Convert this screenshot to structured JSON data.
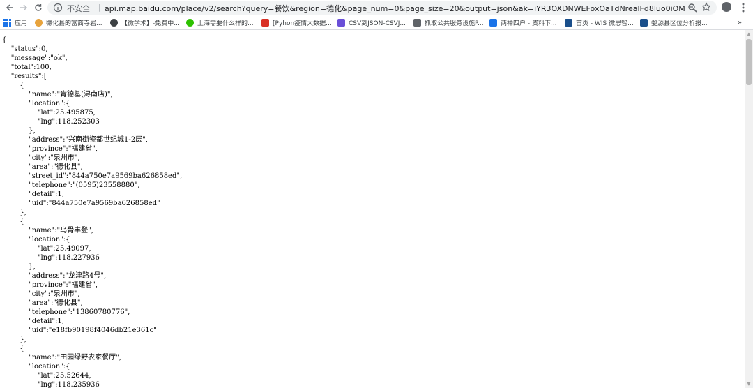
{
  "browser": {
    "insecure_label": "不安全",
    "url": "api.map.baidu.com/place/v2/search?query=餐饮&region=德化&page_num=0&page_size=20&output=json&ak=iYR3OXDNWEFoxOaTdNrealFd8luo0iOM"
  },
  "bookmarks": [
    {
      "label": "应用",
      "icon": "apps-grid-icon",
      "color": "#1a73e8"
    },
    {
      "label": "德化县的富裔寺岩...",
      "icon": "site-favicon",
      "color": "#e8a33c"
    },
    {
      "label": "【微学术】-免费中...",
      "icon": "site-favicon",
      "color": "#3c4043"
    },
    {
      "label": "上海需要什么样的...",
      "icon": "wechat-icon",
      "color": "#2dc100"
    },
    {
      "label": "[Pyhon疫情大数据...",
      "icon": "csdn-icon",
      "color": "#d93025"
    },
    {
      "label": "CSV到JSON-CSVJ...",
      "icon": "arrow-icon",
      "color": "#6a4fd8"
    },
    {
      "label": "抓取公共服务设施P...",
      "icon": "site-favicon",
      "color": "#5f6368"
    },
    {
      "label": "两禅四户 - 资料下...",
      "icon": "code-icon",
      "color": "#1a73e8"
    },
    {
      "label": "首页 - WIS 微思智...",
      "icon": "site-favicon",
      "color": "#1a4f8b"
    },
    {
      "label": "婺源县区位分析报...",
      "icon": "site-favicon",
      "color": "#1a4f8b"
    }
  ],
  "json_text": "{\n    \"status\":0,\n    \"message\":\"ok\",\n    \"total\":100,\n    \"results\":[\n        {\n            \"name\":\"肯德基(浔南店)\",\n            \"location\":{\n                \"lat\":25.495875,\n                \"lng\":118.252303\n            },\n            \"address\":\"兴南街瓷都世纪城1-2层\",\n            \"province\":\"福建省\",\n            \"city\":\"泉州市\",\n            \"area\":\"德化县\",\n            \"street_id\":\"844a750e7a9569ba626858ed\",\n            \"telephone\":\"(0595)23558880\",\n            \"detail\":1,\n            \"uid\":\"844a750e7a9569ba626858ed\"\n        },\n        {\n            \"name\":\"乌骨丰登\",\n            \"location\":{\n                \"lat\":25.49097,\n                \"lng\":118.227936\n            },\n            \"address\":\"龙津路4号\",\n            \"province\":\"福建省\",\n            \"city\":\"泉州市\",\n            \"area\":\"德化县\",\n            \"telephone\":\"13860780776\",\n            \"detail\":1,\n            \"uid\":\"e18fb90198f4046db21e361c\"\n        },\n        {\n            \"name\":\"田园绿野农家餐厅\",\n            \"location\":{\n                \"lat\":25.52644,\n                \"lng\":118.235936"
}
